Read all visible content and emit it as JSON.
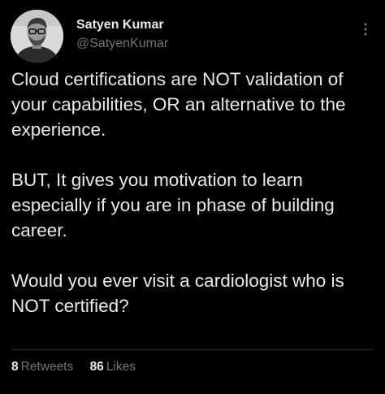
{
  "author": {
    "name": "Satyen Kumar",
    "handle": "@SatyenKumar",
    "avatar_icon": "profile-photo-person-glasses"
  },
  "menu": {
    "more_icon": "vertical-ellipsis-icon"
  },
  "tweet": {
    "paragraphs": [
      "Cloud certifications are NOT validation of your capabilities, OR an alternative to the experience.",
      "BUT, It gives you motivation to learn especially if you are in phase of building career.",
      "Would you ever visit a cardiologist who is NOT certified?"
    ]
  },
  "stats": {
    "retweets_count": "8",
    "retweets_label": "Retweets",
    "likes_count": "86",
    "likes_label": "Likes"
  },
  "colors": {
    "background": "#000000",
    "primary_text": "#e7e9ea",
    "secondary_text": "#71767b",
    "divider": "#2f3336"
  }
}
